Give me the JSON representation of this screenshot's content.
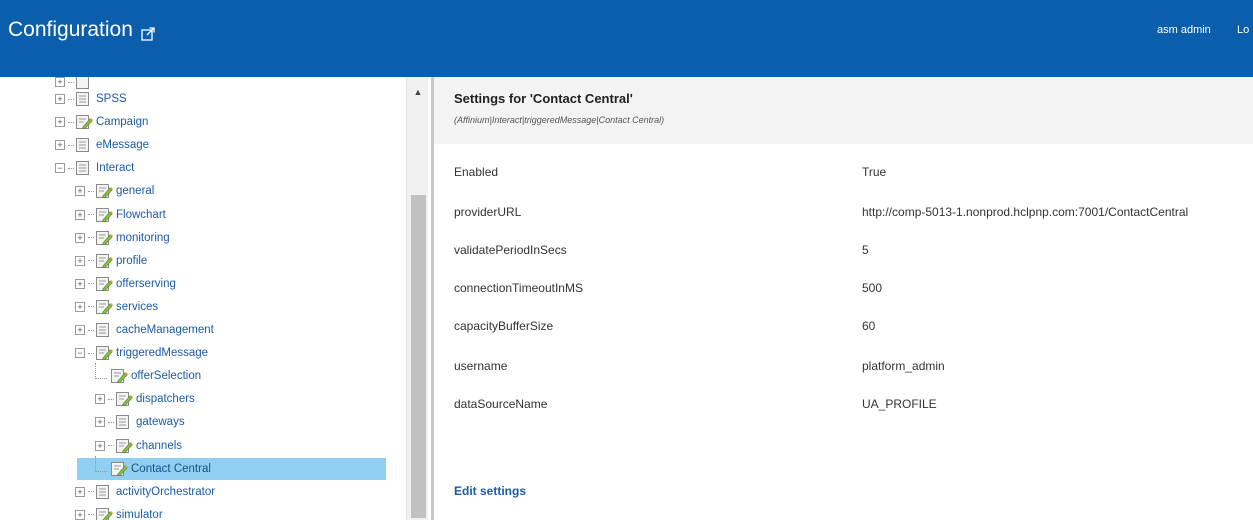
{
  "header": {
    "title": "Configuration",
    "user": "asm admin",
    "logout_label": "Lo"
  },
  "tree": {
    "items": [
      {
        "label": "SPSS",
        "icon": "node-icon",
        "level": 0,
        "expanded": false
      },
      {
        "label": "Campaign",
        "icon": "edit-node-icon",
        "level": 0,
        "expanded": false
      },
      {
        "label": "eMessage",
        "icon": "node-icon",
        "level": 0,
        "expanded": false
      },
      {
        "label": "Interact",
        "icon": "node-icon",
        "level": 0,
        "expanded": true
      },
      {
        "label": "general",
        "icon": "edit-node-icon",
        "level": 1,
        "expanded": false
      },
      {
        "label": "Flowchart",
        "icon": "edit-node-icon",
        "level": 1,
        "expanded": false
      },
      {
        "label": "monitoring",
        "icon": "edit-node-icon",
        "level": 1,
        "expanded": false
      },
      {
        "label": "profile",
        "icon": "edit-node-icon",
        "level": 1,
        "expanded": false
      },
      {
        "label": "offerserving",
        "icon": "edit-node-icon",
        "level": 1,
        "expanded": false
      },
      {
        "label": "services",
        "icon": "edit-node-icon",
        "level": 1,
        "expanded": false
      },
      {
        "label": "cacheManagement",
        "icon": "node-icon",
        "level": 1,
        "expanded": false
      },
      {
        "label": "triggeredMessage",
        "icon": "edit-node-icon",
        "level": 1,
        "expanded": true
      },
      {
        "label": "offerSelection",
        "icon": "edit-node-icon",
        "level": 2,
        "leaf": true
      },
      {
        "label": "dispatchers",
        "icon": "edit-node-icon",
        "level": 2,
        "expanded": false
      },
      {
        "label": "gateways",
        "icon": "node-icon",
        "level": 2,
        "expanded": false
      },
      {
        "label": "channels",
        "icon": "edit-node-icon",
        "level": 2,
        "expanded": false
      },
      {
        "label": "Contact Central",
        "icon": "edit-node-icon",
        "level": 2,
        "leaf": true,
        "selected": true
      },
      {
        "label": "activityOrchestrator",
        "icon": "node-icon",
        "level": 1,
        "expanded": false
      },
      {
        "label": "simulator",
        "icon": "edit-node-icon",
        "level": 1,
        "expanded": false
      }
    ]
  },
  "settings": {
    "title": "Settings for 'Contact Central'",
    "path": "(Affinium|Interact|triggeredMessage|Contact Central)",
    "properties": [
      {
        "name": "Enabled",
        "value": "True"
      },
      {
        "name": "providerURL",
        "value": "http://comp-5013-1.nonprod.hclpnp.com:7001/ContactCentral"
      },
      {
        "name": "validatePeriodInSecs",
        "value": "5"
      },
      {
        "name": "connectionTimeoutInMS",
        "value": "500"
      },
      {
        "name": "capacityBufferSize",
        "value": "60"
      },
      {
        "name": "username",
        "value": "platform_admin"
      },
      {
        "name": "dataSourceName",
        "value": "UA_PROFILE"
      }
    ],
    "edit_label": "Edit settings"
  },
  "colors": {
    "header_bg": "#0a5eab",
    "selected_bg": "#8fd0f2",
    "link": "#1c5aa6"
  }
}
